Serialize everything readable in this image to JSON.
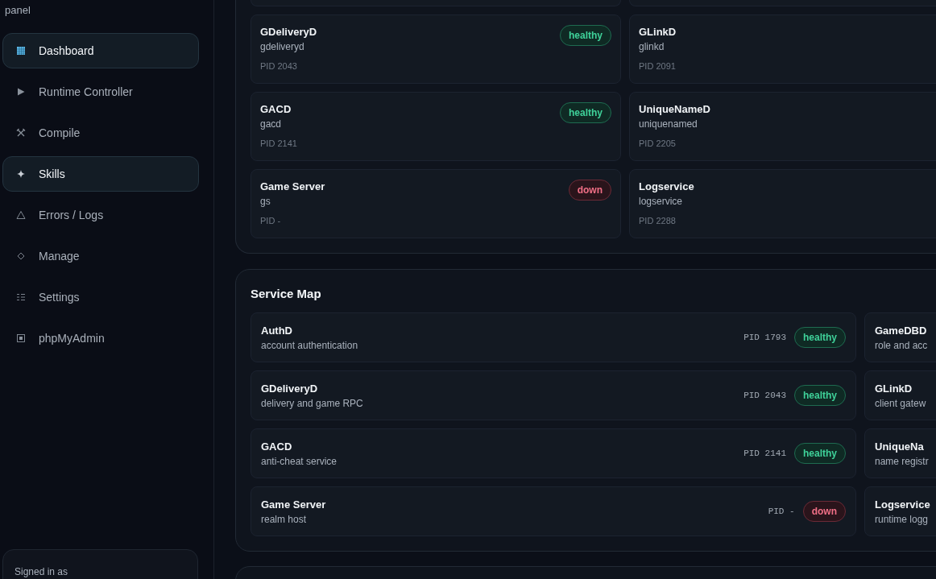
{
  "sidebar": {
    "brand_tail": "panel",
    "items": [
      {
        "label": "Dashboard",
        "selected": true
      },
      {
        "label": "Runtime Controller",
        "selected": false
      },
      {
        "label": "Compile",
        "selected": false
      },
      {
        "label": "Skills",
        "selected": true
      },
      {
        "label": "Errors / Logs",
        "selected": false
      },
      {
        "label": "Manage",
        "selected": false
      },
      {
        "label": "Settings",
        "selected": false
      },
      {
        "label": "phpMyAdmin",
        "selected": false
      }
    ],
    "account": {
      "label": "Signed in as"
    }
  },
  "processes": [
    {
      "name": "GDeliveryD",
      "binary": "gdeliveryd",
      "pid": "PID 2043",
      "badge": "healthy",
      "healthy": true
    },
    {
      "name": "GLinkD",
      "binary": "glinkd",
      "pid": "PID 2091"
    },
    {
      "name": "GACD",
      "binary": "gacd",
      "pid": "PID 2141",
      "badge": "healthy",
      "healthy": true
    },
    {
      "name": "UniqueNameD",
      "binary": "uniquenamed",
      "pid": "PID 2205"
    },
    {
      "name": "Game Server",
      "binary": "gs",
      "pid": "PID -",
      "badge": "down",
      "healthy": false
    },
    {
      "name": "Logservice",
      "binary": "logservice",
      "pid": "PID 2288"
    }
  ],
  "service_map": {
    "title": "Service Map",
    "services": [
      {
        "name": "AuthD",
        "description": "account authentication",
        "pid": "PID 1793",
        "badge": "healthy",
        "healthy": true
      },
      {
        "name": "GameDBD",
        "description": "role and acc"
      },
      {
        "name": "GDeliveryD",
        "description": "delivery and game RPC",
        "pid": "PID 2043",
        "badge": "healthy",
        "healthy": true
      },
      {
        "name": "GLinkD",
        "description": "client gatew"
      },
      {
        "name": "GACD",
        "description": "anti-cheat service",
        "pid": "PID 2141",
        "badge": "healthy",
        "healthy": true
      },
      {
        "name": "UniqueNa",
        "description": "name registr"
      },
      {
        "name": "Game Server",
        "description": "realm host",
        "pid": "PID -",
        "badge": "down",
        "healthy": false
      },
      {
        "name": "Logservice",
        "description": "runtime logg"
      }
    ]
  }
}
